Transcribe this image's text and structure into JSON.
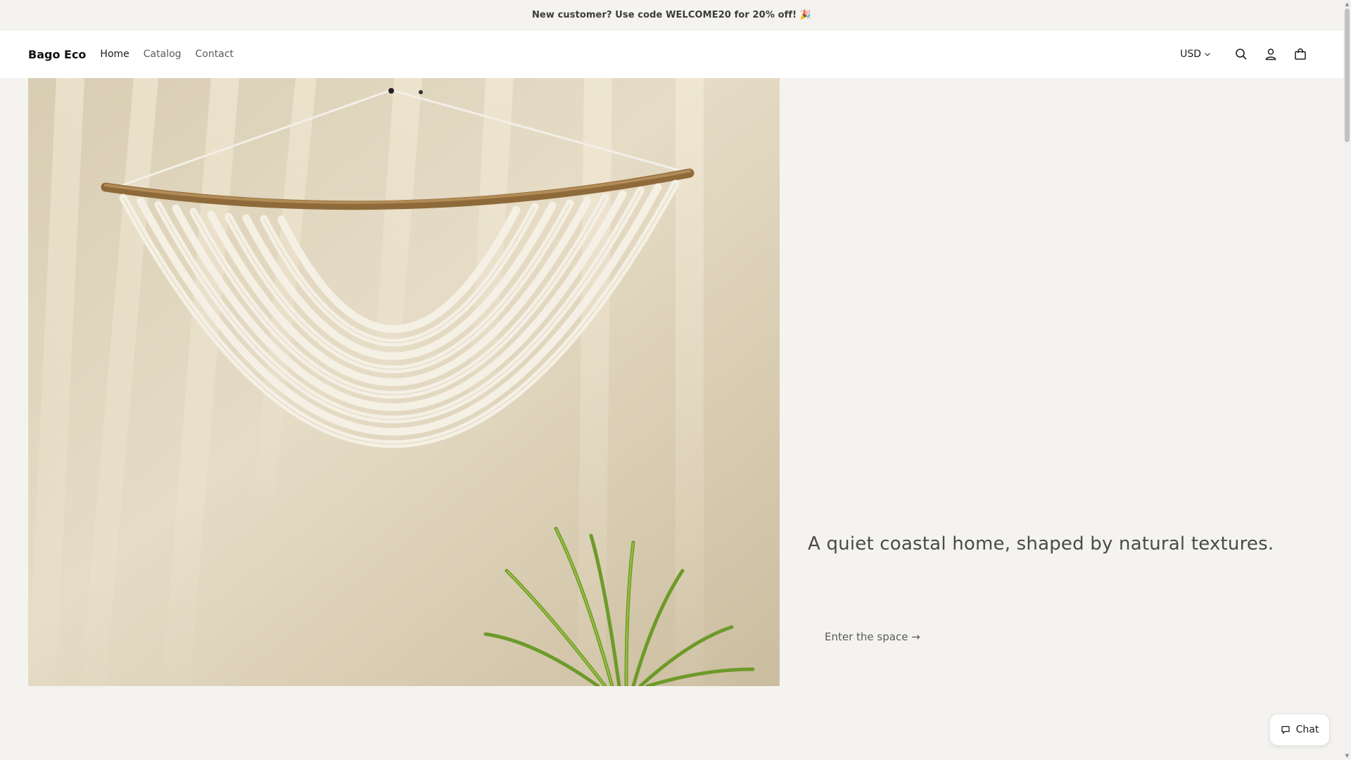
{
  "announcement": {
    "text": "New customer? Use code WELCOME20 for 20% off! 🎉"
  },
  "header": {
    "logo": "Bago Eco",
    "nav": [
      {
        "label": "Home",
        "active": true
      },
      {
        "label": "Catalog",
        "active": false
      },
      {
        "label": "Contact",
        "active": false
      }
    ],
    "currency": "USD",
    "icons": [
      "search-icon",
      "account-icon",
      "cart-icon"
    ]
  },
  "hero": {
    "image_alt": "Shell garland wall hanging on driftwood",
    "heading": "A quiet coastal home, shaped by natural textures.",
    "cta": "Enter the space →"
  },
  "chat": {
    "label": "Chat"
  },
  "colors": {
    "background": "#f4f3ef",
    "header": "#ffffff",
    "text": "#1c1c1c"
  }
}
